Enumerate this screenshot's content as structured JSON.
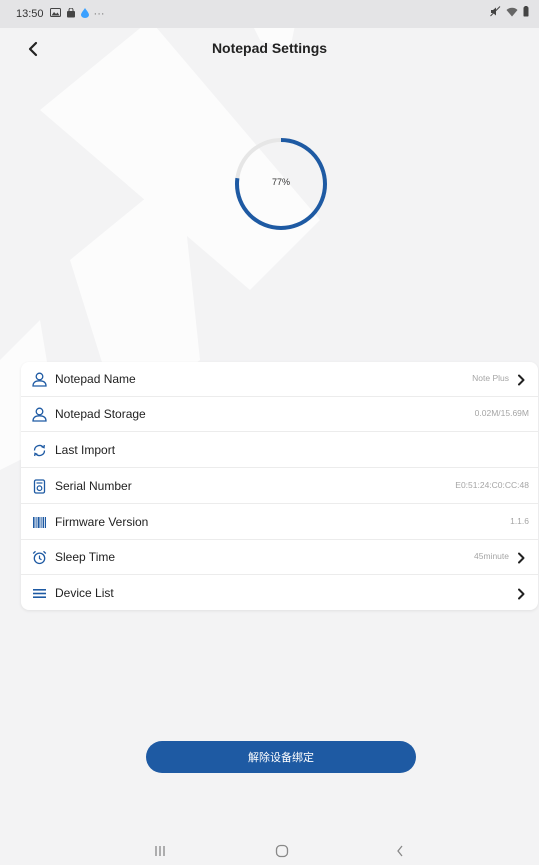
{
  "status_bar": {
    "time": "13:50",
    "more": "···"
  },
  "header": {
    "title": "Notepad Settings"
  },
  "storage": {
    "percent_label": "77%",
    "percent_value": 0.77,
    "ring_color": "#1e5aa3",
    "track_color": "#e6e6e6"
  },
  "settings": {
    "rows": [
      {
        "label": "Notepad Name",
        "value": "Note Plus",
        "icon": "person-icon",
        "chevron": true
      },
      {
        "label": "Notepad Storage",
        "value": "0.02M/15.69M",
        "icon": "person-icon",
        "chevron": false
      },
      {
        "label": "Last Import",
        "value": "",
        "icon": "sync-icon",
        "chevron": false
      },
      {
        "label": "Serial Number",
        "value": "E0:51:24:C0:CC:48",
        "icon": "device-icon",
        "chevron": false
      },
      {
        "label": "Firmware Version",
        "value": "1.1.6",
        "icon": "barcode-icon",
        "chevron": false
      },
      {
        "label": "Sleep Time",
        "value": "45minute",
        "icon": "alarm-clock-icon",
        "chevron": true
      },
      {
        "label": "Device List",
        "value": "",
        "icon": "list-icon",
        "chevron": true
      }
    ]
  },
  "unbind_button": {
    "label": "解除设备绑定",
    "color": "#1e5aa3"
  },
  "colors": {
    "accent": "#1e5aa3",
    "background": "#f3f3f4"
  }
}
